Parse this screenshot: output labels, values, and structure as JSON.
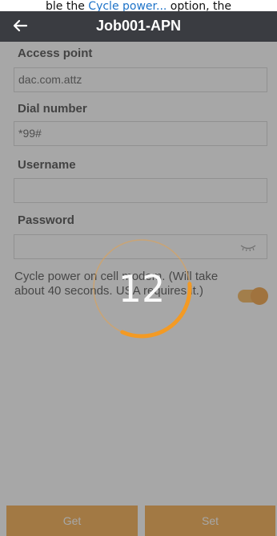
{
  "caption": {
    "prefix": "ble the ",
    "link": "Cycle power...",
    "suffix": " option, the"
  },
  "header": {
    "back_icon": "arrow-left-icon",
    "title": "Job001-APN"
  },
  "form": {
    "access_point": {
      "label": "Access point",
      "value": "dac.com.attz"
    },
    "dial_number": {
      "label": "Dial number",
      "value": "*99#"
    },
    "username": {
      "label": "Username",
      "value": ""
    },
    "password": {
      "label": "Password",
      "value": "",
      "visibility_icon": "eye-closed-icon"
    },
    "cycle_power": {
      "label": "Cycle power on cell modem. (Will take about 40 seconds. USA requires it.)",
      "enabled": true
    }
  },
  "buttons": {
    "get": "Get",
    "set": "Set"
  },
  "loading": {
    "countdown": "12",
    "progress": 0.33
  },
  "colors": {
    "accent": "#f39a24",
    "appbar": "#3a3c41"
  }
}
